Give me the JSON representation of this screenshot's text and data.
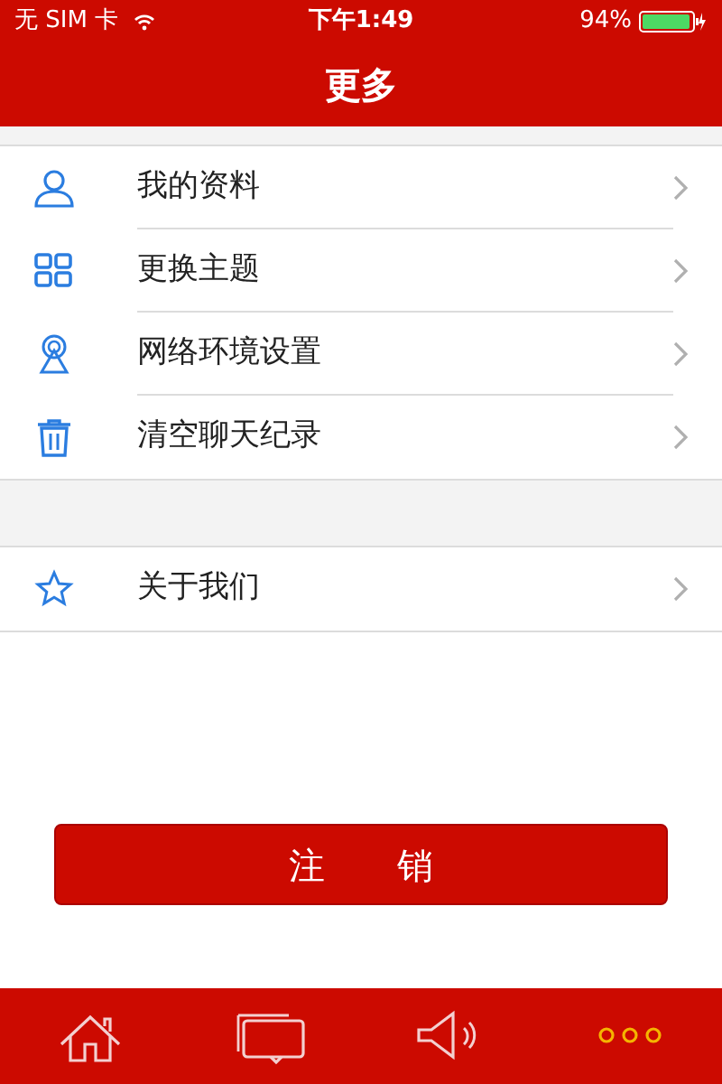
{
  "status_bar": {
    "carrier": "无 SIM 卡",
    "time": "下午1:49",
    "battery": "94%"
  },
  "title": "更多",
  "groups": [
    [
      {
        "kind": "profile",
        "label": "我的资料"
      },
      {
        "kind": "theme",
        "label": "更换主题"
      },
      {
        "kind": "network",
        "label": "网络环境设置"
      },
      {
        "kind": "trash",
        "label": "清空聊天纪录"
      }
    ],
    [
      {
        "kind": "star",
        "label": "关于我们"
      }
    ]
  ],
  "logout_button": "注　　销",
  "tabs": [
    {
      "kind": "home",
      "selected": false
    },
    {
      "kind": "chat",
      "selected": false
    },
    {
      "kind": "sound",
      "selected": false
    },
    {
      "kind": "more",
      "selected": true
    }
  ]
}
